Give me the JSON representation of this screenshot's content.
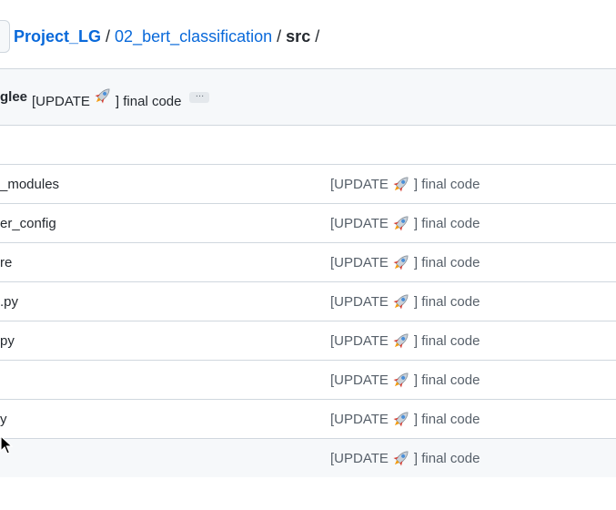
{
  "breadcrumb": {
    "repo": "Project_LG",
    "separator": "/",
    "folder": "02_bert_classification",
    "current": "src",
    "trailing": "/"
  },
  "latest_commit": {
    "author": "glee",
    "message_prefix": "[UPDATE",
    "message_suffix": "] final code",
    "more_label": "…"
  },
  "files": [
    {
      "name": "_modules",
      "commit_prefix": "[UPDATE",
      "commit_suffix": "] final code"
    },
    {
      "name": "er_config",
      "commit_prefix": "[UPDATE",
      "commit_suffix": "] final code"
    },
    {
      "name": "re",
      "commit_prefix": "[UPDATE",
      "commit_suffix": "] final code"
    },
    {
      "name": ".py",
      "commit_prefix": "[UPDATE",
      "commit_suffix": "] final code"
    },
    {
      "name": "py",
      "commit_prefix": "[UPDATE",
      "commit_suffix": "] final code"
    },
    {
      "name": "",
      "commit_prefix": "[UPDATE",
      "commit_suffix": "] final code"
    },
    {
      "name": "y",
      "commit_prefix": "[UPDATE",
      "commit_suffix": "] final code"
    },
    {
      "name": "",
      "commit_prefix": "[UPDATE",
      "commit_suffix": "] final code"
    }
  ],
  "icons": {
    "commit_emoji": "rocket-icon",
    "pointer": "mouse-cursor-icon"
  },
  "colors": {
    "link": "#0969da",
    "text": "#24292f",
    "muted": "#57606a",
    "border": "#d0d7de",
    "header_bg": "#f6f8fa"
  }
}
